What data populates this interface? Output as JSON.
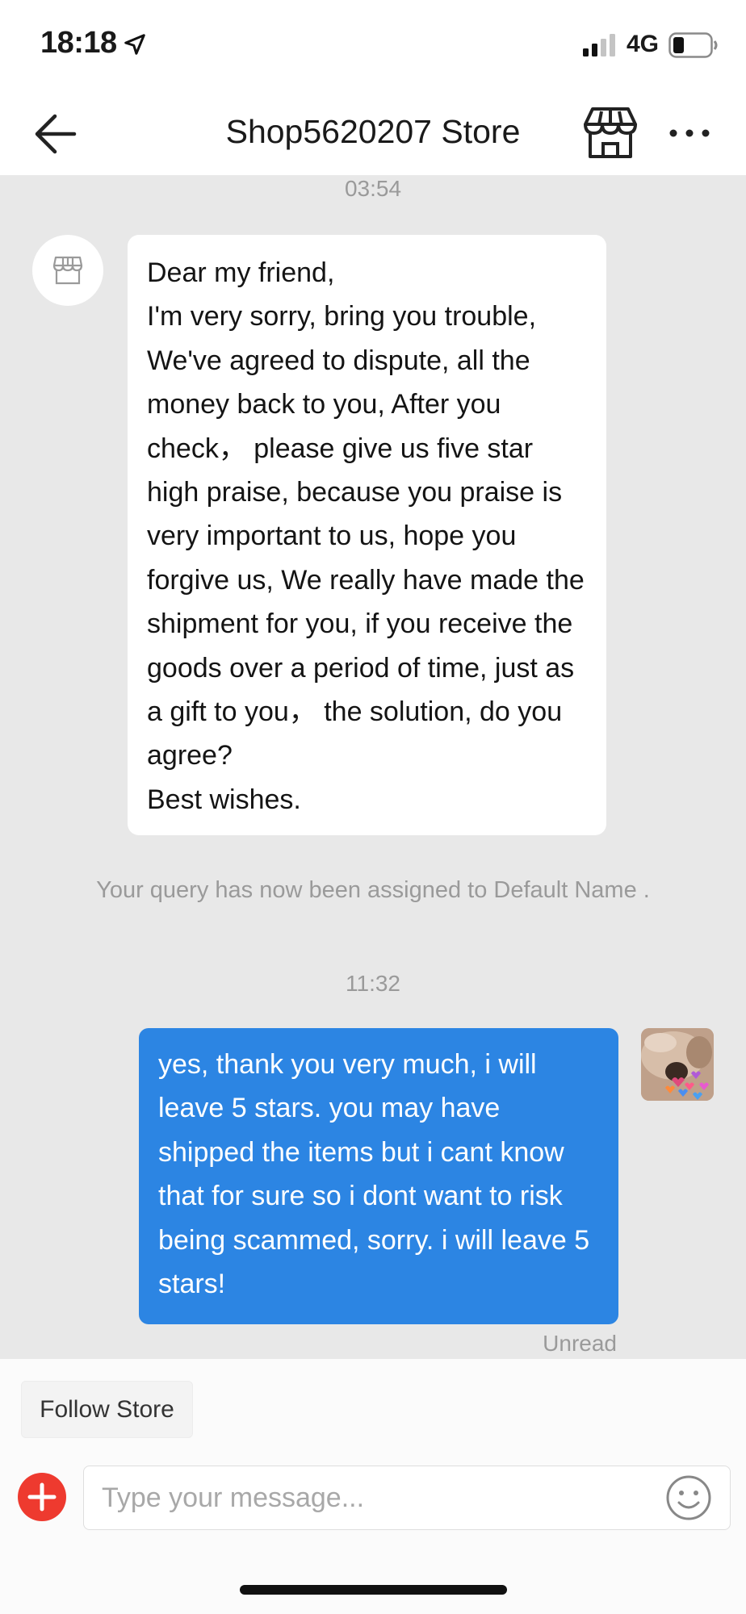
{
  "status_bar": {
    "time": "18:18",
    "network": "4G",
    "icons": [
      "location-arrow-icon",
      "signal-icon",
      "battery-icon"
    ]
  },
  "header": {
    "title": "Shop5620207 Store",
    "icons": [
      "back-arrow-icon",
      "store-icon",
      "more-icon"
    ]
  },
  "chat": {
    "timestamp_1": "03:54",
    "incoming_message": "Dear my friend,\nI'm very sorry, bring you trouble, We've agreed to dispute, all the money back to you, After you check， please  give us five star high praise, because you praise is very important to us, hope you forgive us, We really have made the shipment for you, if you receive the goods over a period of time, just as a gift to you， the solution, do you agree?\nBest wishes.",
    "system_notice": "Your query has now been assigned to Default Name .",
    "timestamp_2": "11:32",
    "outgoing_message": "yes, thank you very much, i will leave 5 stars. you may have shipped the items but i cant know that for sure so i dont want to risk being scammed, sorry. i will leave 5 stars!",
    "read_status": "Unread"
  },
  "bottom_bar": {
    "follow_label": "Follow Store",
    "input_placeholder": "Type your message...",
    "input_value": "",
    "icons": [
      "plus-icon",
      "emoji-icon"
    ]
  },
  "colors": {
    "outgoing_bubble": "#2c85e3",
    "incoming_bubble": "#ffffff",
    "chat_background": "#e8e8e8",
    "add_button": "#ee3a2f"
  }
}
